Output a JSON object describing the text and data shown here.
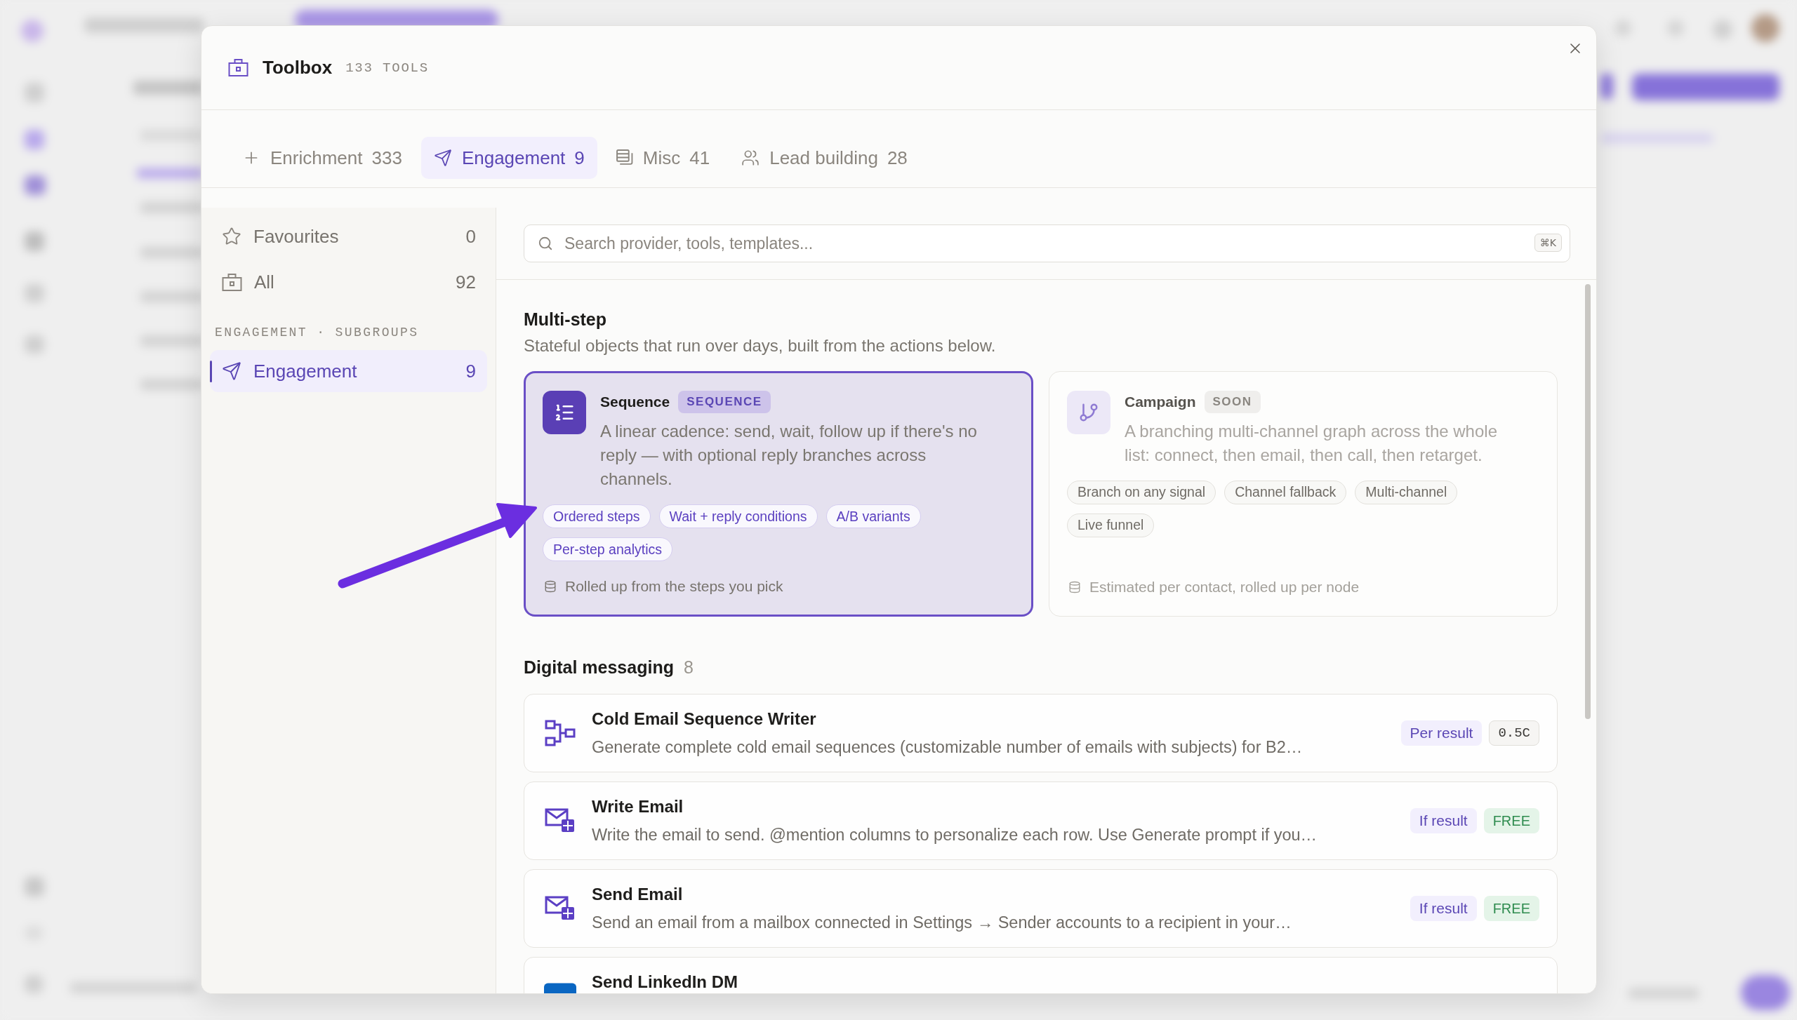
{
  "dialog": {
    "title": "Toolbox",
    "subtitle": "133 TOOLS"
  },
  "tabs": [
    {
      "label": "Enrichment",
      "count": "333",
      "selected": false
    },
    {
      "label": "Engagement",
      "count": "9",
      "selected": true
    },
    {
      "label": "Misc",
      "count": "41",
      "selected": false
    },
    {
      "label": "Lead building",
      "count": "28",
      "selected": false
    }
  ],
  "sidebar": {
    "items": [
      {
        "label": "Favourites",
        "count": "0",
        "selected": false
      },
      {
        "label": "All",
        "count": "92",
        "selected": false
      }
    ],
    "group_heading": "ENGAGEMENT · SUBGROUPS",
    "subgroups": [
      {
        "label": "Engagement",
        "count": "9",
        "selected": true
      }
    ]
  },
  "search": {
    "placeholder": "Search provider, tools, templates...",
    "shortcut": "⌘K"
  },
  "multi_step": {
    "title": "Multi-step",
    "description": "Stateful objects that run over days, built from the actions below.",
    "cards": [
      {
        "title": "Sequence",
        "badge": "SEQUENCE",
        "description": "A linear cadence: send, wait, follow up if there's no reply — with optional reply branches across channels.",
        "features": [
          "Ordered steps",
          "Wait + reply conditions",
          "A/B variants",
          "Per-step analytics"
        ],
        "footnote": "Rolled up from the steps you pick",
        "selected": true,
        "disabled": false
      },
      {
        "title": "Campaign",
        "badge": "SOON",
        "description": "A branching multi-channel graph across the whole list: connect, then email, then call, then retarget.",
        "features": [
          "Branch on any signal",
          "Channel fallback",
          "Multi-channel",
          "Live funnel"
        ],
        "footnote": "Estimated per contact, rolled up per node",
        "selected": false,
        "disabled": true
      }
    ]
  },
  "digital_messaging": {
    "title": "Digital messaging",
    "count": "8",
    "tools": [
      {
        "name": "Cold Email Sequence Writer",
        "description": "Generate complete cold email sequences (customizable number of emails with subjects) for B2…",
        "billing": "Per result",
        "price": "0.5C",
        "kind": "paid"
      },
      {
        "name": "Write Email",
        "description": "Write the email to send. @mention columns to personalize each row. Use Generate prompt if you…",
        "billing": "If result",
        "price": "FREE",
        "kind": "free"
      },
      {
        "name": "Send Email",
        "description": "Send an email from a mailbox connected in Settings → Sender accounts to a recipient in your…",
        "billing": "If result",
        "price": "FREE",
        "kind": "free"
      },
      {
        "name": "Send LinkedIn DM"
      }
    ]
  }
}
